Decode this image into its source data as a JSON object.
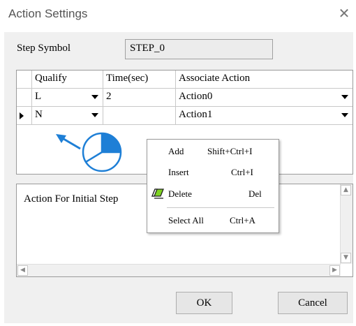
{
  "window": {
    "title": "Action Settings",
    "close_glyph": "✕"
  },
  "step": {
    "label": "Step Symbol",
    "value": "STEP_0"
  },
  "grid": {
    "headers": {
      "qualify": "Qualify",
      "time": "Time(sec)",
      "action": "Associate Action"
    },
    "rows": [
      {
        "qualify": "L",
        "time": "2",
        "action": "Action0",
        "current": false
      },
      {
        "qualify": "N",
        "time": "",
        "action": "Action1",
        "current": true
      }
    ]
  },
  "action_text": {
    "content": "Action For Initial Step"
  },
  "buttons": {
    "ok": "OK",
    "cancel": "Cancel"
  },
  "context_menu": {
    "items": [
      {
        "label": "Add",
        "shortcut": "Shift+Ctrl+I",
        "icon": null
      },
      {
        "label": "Insert",
        "shortcut": "Ctrl+I",
        "icon": null
      },
      {
        "label": "Delete",
        "shortcut": "Del",
        "icon": "eraser-icon"
      },
      {
        "label": "Select All",
        "shortcut": "Ctrl+A",
        "icon": null
      }
    ]
  },
  "annotation": {
    "arrow_color": "#1e7fd6",
    "pie_fill_fraction": 0.25,
    "icons": [
      "pointer-arrow-icon",
      "mouse-right-click-icon"
    ]
  }
}
